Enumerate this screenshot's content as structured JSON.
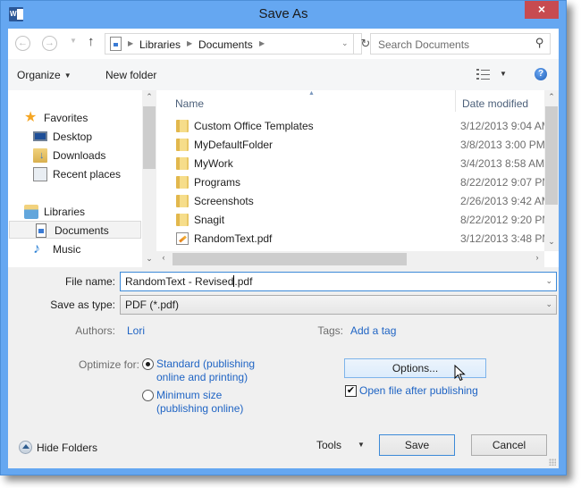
{
  "window": {
    "title": "Save As",
    "app_icon": "word-icon",
    "close_label": "×",
    "accent_color": "#65a7f1",
    "close_color": "#c74b50"
  },
  "navbar": {
    "back_icon": "back-arrow-icon",
    "forward_icon": "forward-arrow-icon",
    "up_icon": "up-arrow-icon",
    "breadcrumb": [
      "Libraries",
      "Documents"
    ],
    "search_placeholder": "Search Documents"
  },
  "toolbar": {
    "organize_label": "Organize",
    "new_folder_label": "New folder"
  },
  "sidebar": {
    "items": [
      {
        "label": "Favorites",
        "icon": "star-icon",
        "level": 0
      },
      {
        "label": "Desktop",
        "icon": "desktop-icon",
        "level": 1
      },
      {
        "label": "Downloads",
        "icon": "downloads-folder-icon",
        "level": 1
      },
      {
        "label": "Recent places",
        "icon": "recent-places-icon",
        "level": 1
      },
      {
        "label": "Libraries",
        "icon": "libraries-icon",
        "level": 0
      },
      {
        "label": "Documents",
        "icon": "documents-icon",
        "level": 1,
        "selected": true
      },
      {
        "label": "Music",
        "icon": "music-icon",
        "level": 1
      }
    ]
  },
  "filelist": {
    "columns": [
      "Name",
      "Date modified"
    ],
    "sorted_by": "Name",
    "rows": [
      {
        "name": "Custom Office Templates",
        "date": "3/12/2013 9:04 AM",
        "type": "folder"
      },
      {
        "name": "MyDefaultFolder",
        "date": "3/8/2013 3:00 PM",
        "type": "folder"
      },
      {
        "name": "MyWork",
        "date": "3/4/2013 8:58 AM",
        "type": "folder"
      },
      {
        "name": "Programs",
        "date": "8/22/2012 9:07 PM",
        "type": "folder"
      },
      {
        "name": "Screenshots",
        "date": "2/26/2013 9:42 AM",
        "type": "folder"
      },
      {
        "name": "Snagit",
        "date": "8/22/2012 9:20 PM",
        "type": "folder"
      },
      {
        "name": "RandomText.pdf",
        "date": "3/12/2013 3:48 PM",
        "type": "pdf"
      }
    ]
  },
  "form": {
    "file_name_label": "File name:",
    "file_name_value_before_caret": "RandomText - Revised",
    "file_name_value_after_caret": ".pdf",
    "save_as_type_label": "Save as type:",
    "save_as_type_value": "PDF (*.pdf)",
    "authors_label": "Authors:",
    "authors_value": "Lori",
    "tags_label": "Tags:",
    "tags_value": "Add a tag",
    "optimize_label": "Optimize for:",
    "optimize_options": [
      {
        "line1": "Standard (publishing",
        "line2": "online and printing)",
        "selected": true
      },
      {
        "line1": "Minimum size",
        "line2": "(publishing online)",
        "selected": false
      }
    ],
    "options_button": "Options...",
    "open_after_label": "Open file after publishing",
    "open_after_checked": true
  },
  "footer": {
    "hide_folders_label": "Hide Folders",
    "tools_label": "Tools",
    "save_label": "Save",
    "cancel_label": "Cancel"
  }
}
